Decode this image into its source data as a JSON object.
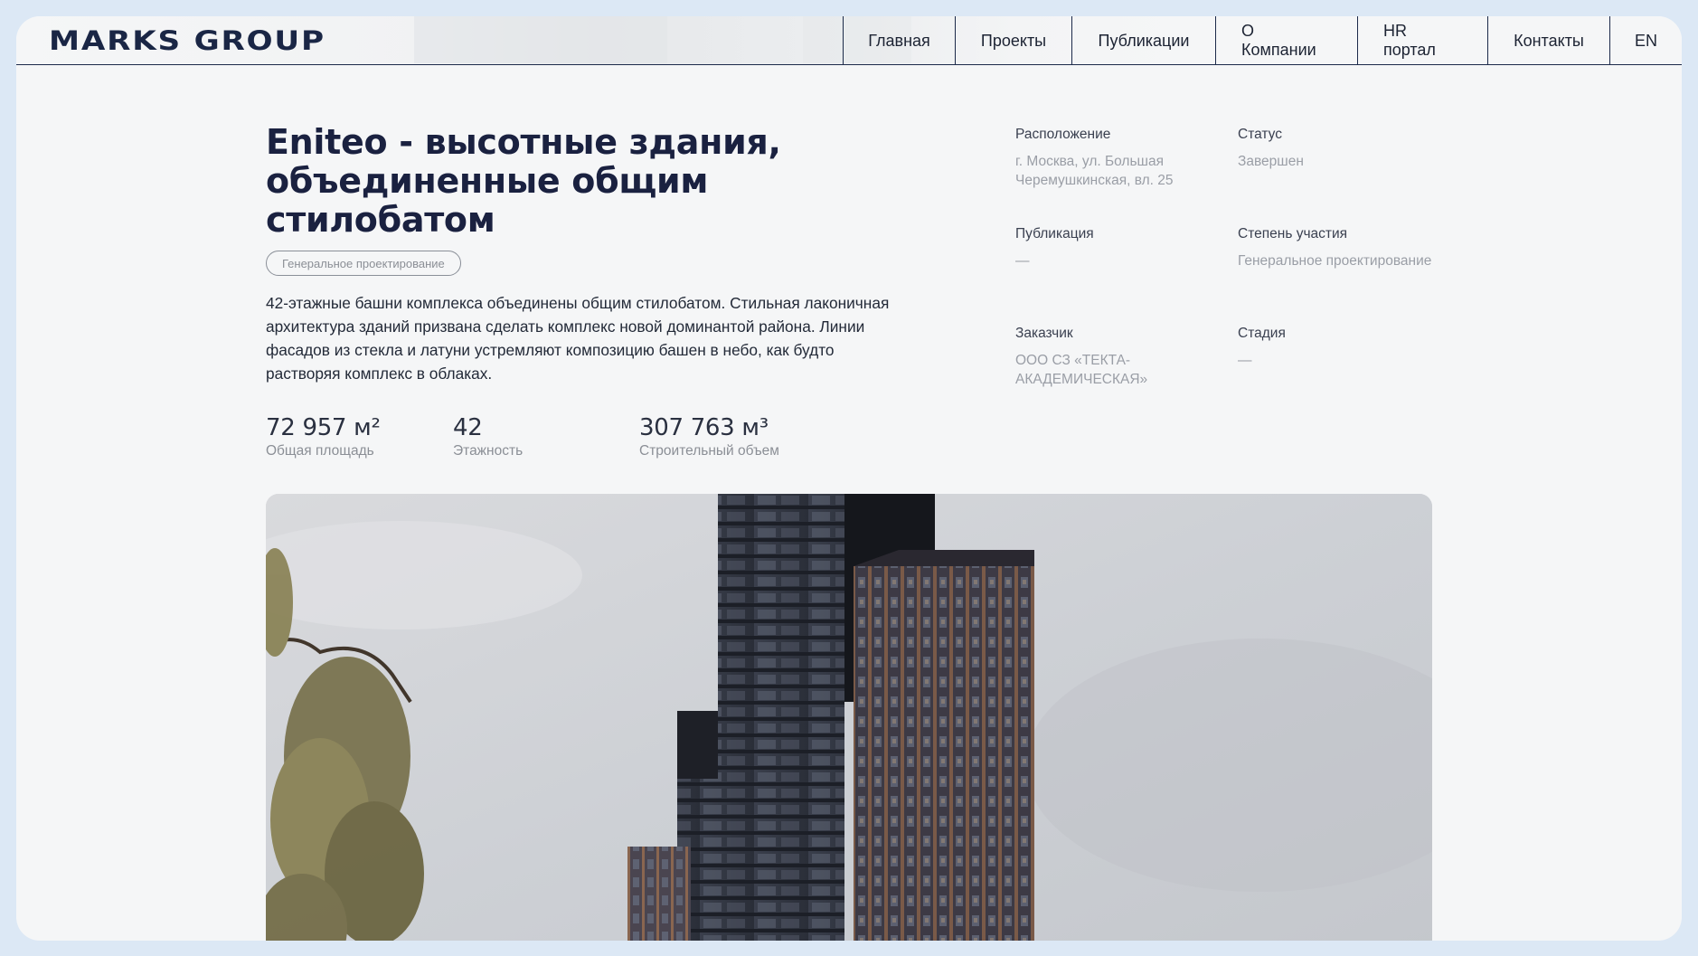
{
  "header": {
    "logo": "MARKS GROUP",
    "nav": [
      {
        "label": "Главная"
      },
      {
        "label": "Проекты"
      },
      {
        "label": "Публикации"
      },
      {
        "label": "О Компании"
      },
      {
        "label": "HR портал"
      },
      {
        "label": "Контакты"
      },
      {
        "label": "EN"
      }
    ]
  },
  "project": {
    "title": "Eniteo - высотные здания, объединенные общим стилобатом",
    "tag": "Генеральное проектирование",
    "description": "42-этажные башни комплекса объединены общим стилобатом. Стильная лаконичная архитектура зданий призвана сделать комплекс новой доминантой района. Линии фасадов из стекла и латуни устремляют композицию башен в небо, как будто растворяя комплекс в облаках.",
    "stats": [
      {
        "value": "72 957 м²",
        "label": "Общая площадь"
      },
      {
        "value": "42",
        "label": "Этажность"
      },
      {
        "value": "307 763 м³",
        "label": "Строительный объем"
      }
    ],
    "meta": {
      "location": {
        "label": "Расположение",
        "value": "г. Москва, ул. Большая Черемушкинская, вл. 25"
      },
      "status": {
        "label": "Статус",
        "value": "Завершен"
      },
      "publication": {
        "label": "Публикация",
        "value": "—"
      },
      "participation": {
        "label": "Степень участия",
        "value": "Генеральное проектирование"
      },
      "client": {
        "label": "Заказчик",
        "value": "ООО СЗ «ТЕКТА-АКАДЕМИЧЕСКАЯ»"
      },
      "stage": {
        "label": "Стадия",
        "value": "—"
      }
    }
  },
  "colors": {
    "brand": "#1a2645",
    "background": "#f5f6f7",
    "outer": "#dce8f5",
    "muted_text": "#9a9ea6"
  },
  "hero_image": {
    "icon": "building-render-image"
  }
}
